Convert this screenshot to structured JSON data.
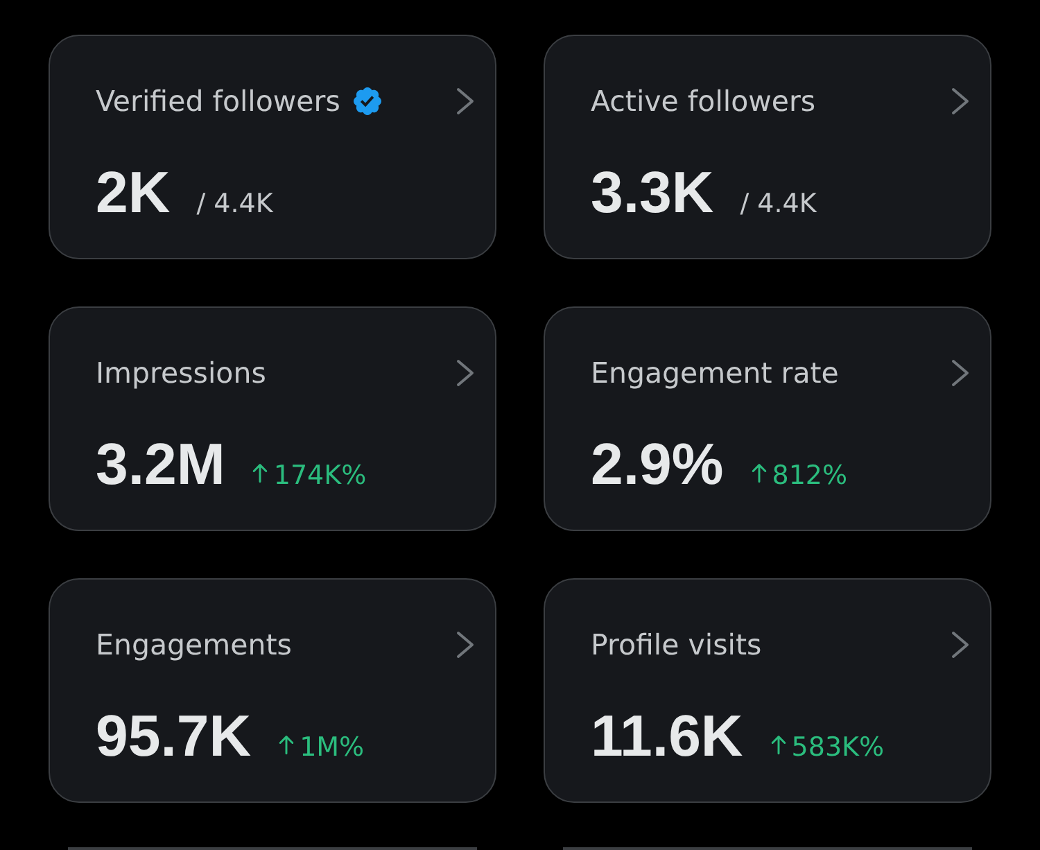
{
  "cards": [
    {
      "title": "Verified followers",
      "verified": true,
      "value": "2K",
      "total": "/ 4.4K"
    },
    {
      "title": "Active followers",
      "verified": false,
      "value": "3.3K",
      "total": "/ 4.4K"
    },
    {
      "title": "Impressions",
      "verified": false,
      "value": "3.2M",
      "rising": true,
      "change": "174K%"
    },
    {
      "title": "Engagement rate",
      "verified": false,
      "value": "2.9%",
      "rising": true,
      "change": "812%"
    },
    {
      "title": "Engagements",
      "verified": false,
      "value": "95.7K",
      "rising": true,
      "change": "1M%"
    },
    {
      "title": "Profile visits",
      "verified": false,
      "value": "11.6K",
      "rising": true,
      "change": "583K%"
    }
  ]
}
